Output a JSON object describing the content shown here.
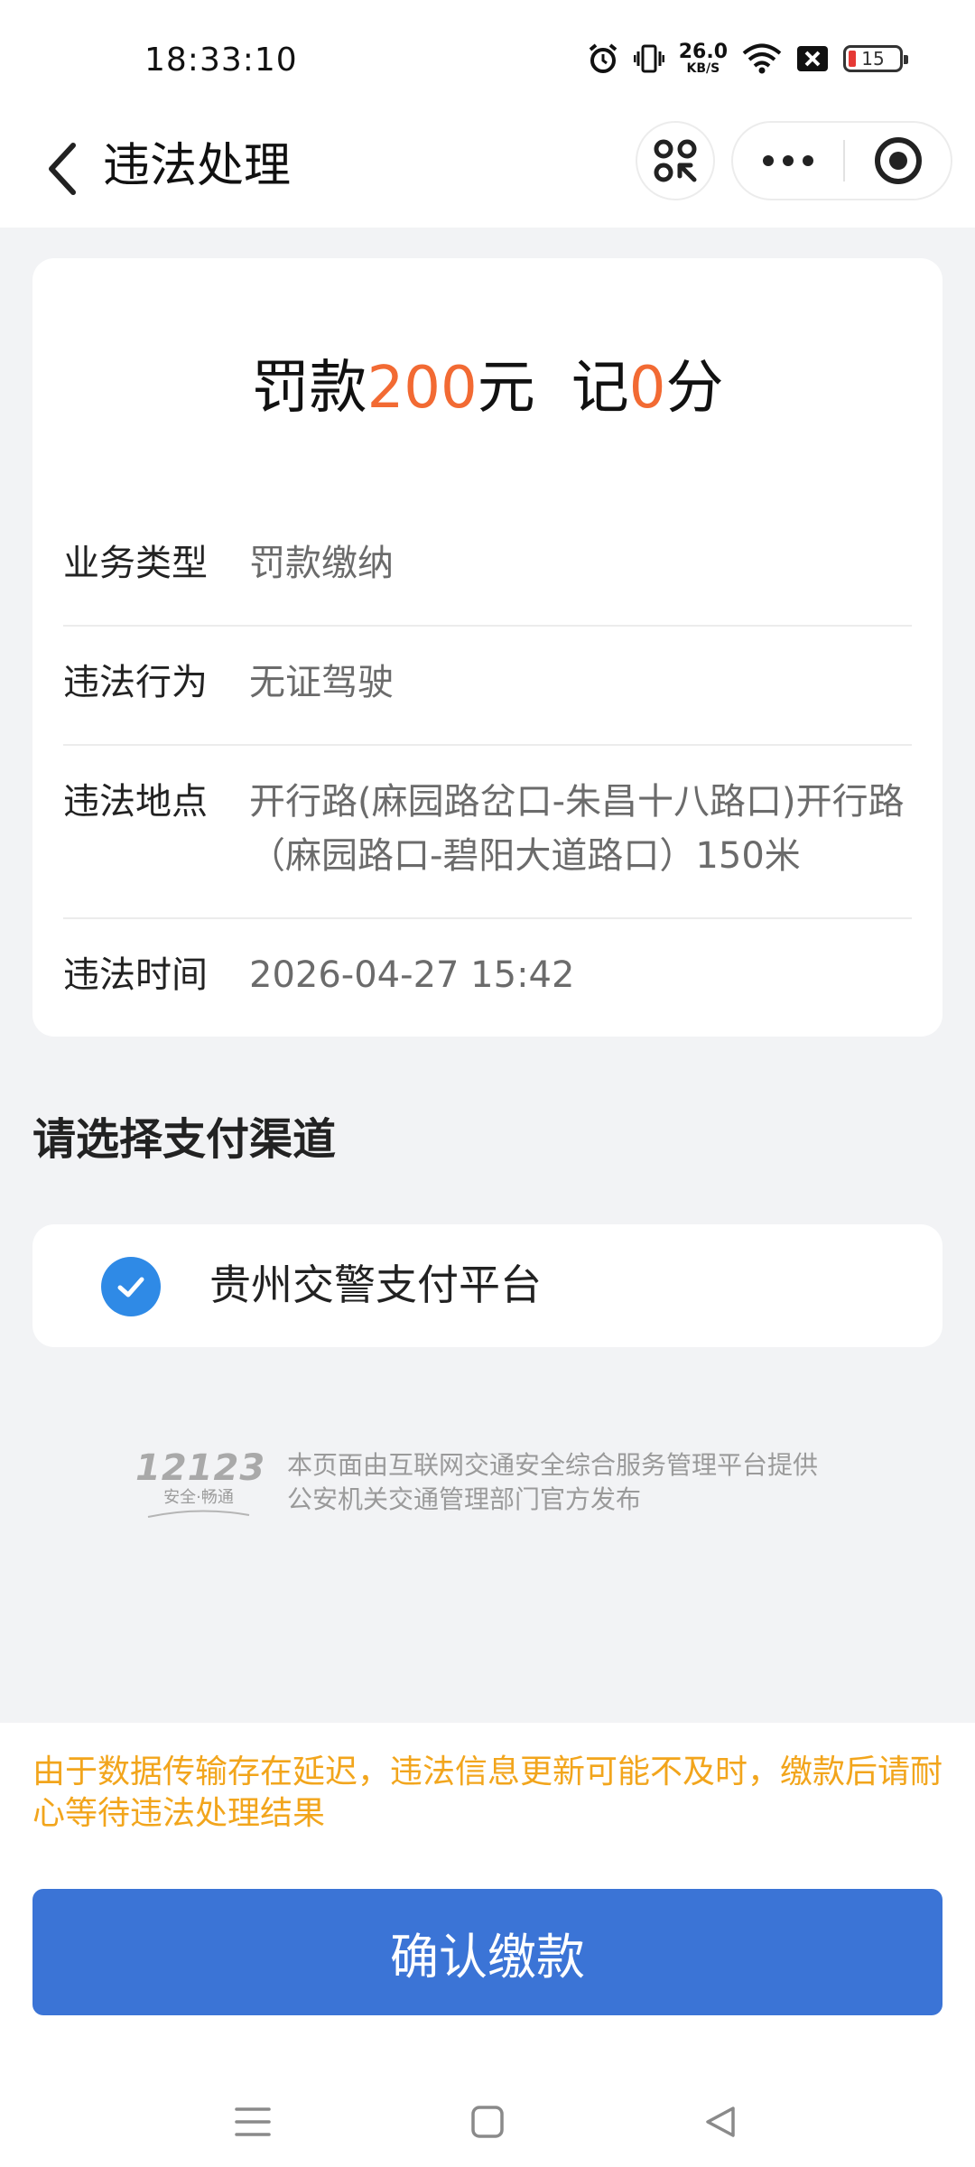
{
  "status_bar": {
    "time": "18:33:10",
    "net_speed_value": "26.0",
    "net_speed_unit": "KB/S",
    "battery_level": "15",
    "icons": [
      "alarm-icon",
      "vibrate-icon",
      "net-speed",
      "wifi-icon",
      "sim-x-icon",
      "battery-icon"
    ]
  },
  "nav": {
    "title": "违法处理"
  },
  "fine": {
    "fine_prefix": "罚款",
    "fine_amount": "200",
    "fine_suffix": "元",
    "points_prefix": "记",
    "points_value": "0",
    "points_suffix": "分"
  },
  "details": [
    {
      "label": "业务类型",
      "value": "罚款缴纳"
    },
    {
      "label": "违法行为",
      "value": "无证驾驶"
    },
    {
      "label": "违法地点",
      "value": "开行路(麻园路岔口-朱昌十八路口)开行路（麻园路口-碧阳大道路口）150米"
    },
    {
      "label": "违法时间",
      "value": "2026-04-27 15:42"
    }
  ],
  "payment": {
    "section_title": "请选择支付渠道",
    "channel_label": "贵州交警支付平台",
    "selected": true
  },
  "brand": {
    "logo_number": "12123",
    "logo_sub": "安全·畅通",
    "line1": "本页面由互联网交通安全综合服务管理平台提供",
    "line2": "公安机关交通管理部门官方发布"
  },
  "footer": {
    "notice": "由于数据传输存在延迟，违法信息更新可能不及时，缴款后请耐心等待违法处理结果",
    "confirm_label": "确认缴款"
  },
  "colors": {
    "highlight": "#f26a33",
    "primary": "#3b74d6",
    "check": "#2f8ae6",
    "notice": "#f2a51c"
  }
}
